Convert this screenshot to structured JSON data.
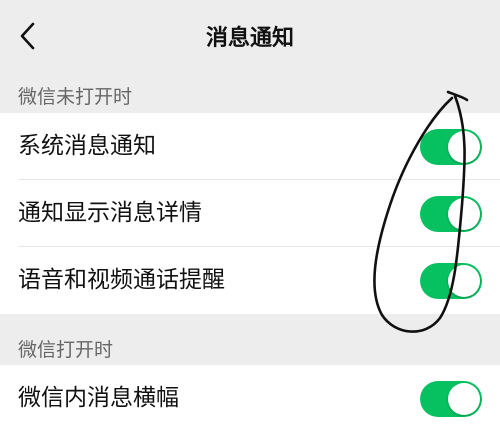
{
  "header": {
    "title": "消息通知",
    "back_icon": "chevron-left-icon"
  },
  "sections": [
    {
      "title": "微信未打开时",
      "items": [
        {
          "label": "系统消息通知",
          "enabled": true
        },
        {
          "label": "通知显示消息详情",
          "enabled": true
        },
        {
          "label": "语音和视频通话提醒",
          "enabled": true
        }
      ]
    },
    {
      "title": "微信打开时",
      "items": [
        {
          "label": "微信内消息横幅",
          "enabled": true
        }
      ]
    }
  ],
  "colors": {
    "toggle_on": "#07c160",
    "background": "#ededed",
    "row_background": "#ffffff",
    "section_text": "#666666"
  }
}
